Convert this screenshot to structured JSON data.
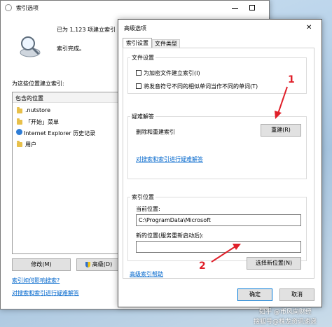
{
  "left_window": {
    "title": "索引选项",
    "status_count": "已为 1,123 项建立索引",
    "status_done": "索引完成。",
    "list_label": "为这些位置建立索引:",
    "list_header": "包含的位置",
    "locations": [
      ".nutstore",
      "「开始」菜单",
      "Internet Explorer 历史记录",
      "用户"
    ],
    "modify_button": "修改(M)",
    "advanced_button": "高级(D)",
    "link_search": "索引如何影响搜索?",
    "link_troubleshoot": "对搜索和索引进行疑难解答"
  },
  "dialog": {
    "title": "高级选项",
    "close_label": "✕",
    "tabs": [
      "索引设置",
      "文件类型"
    ],
    "file_settings_label": "文件设置",
    "checkbox_encrypt": "为加密文件建立索引(I)",
    "checkbox_diacritics": "将发音符号不同的相似单词当作不同的单词(T)",
    "troubleshoot_label": "疑难解答",
    "rebuild_text": "删除和重建索引",
    "rebuild_button": "重建(R)",
    "troubleshoot_link": "对搜索和索引进行疑难解答",
    "index_location_label": "索引位置",
    "current_location_label": "当前位置:",
    "current_location_value": "C:\\ProgramData\\Microsoft",
    "new_location_label": "新的位置(服务重新启动后):",
    "new_location_value": "",
    "select_new_button": "选择新位置(N)",
    "help_link": "高级索引帮助",
    "ok_button": "确定",
    "cancel_button": "取消"
  },
  "annotations": {
    "arrow1_label": "1",
    "arrow2_label": "2",
    "arrow_color": "#e0202a"
  },
  "watermark": {
    "line1": "知乎 @币风向财经",
    "line2": "搜狐号@株龙资讯速递"
  }
}
